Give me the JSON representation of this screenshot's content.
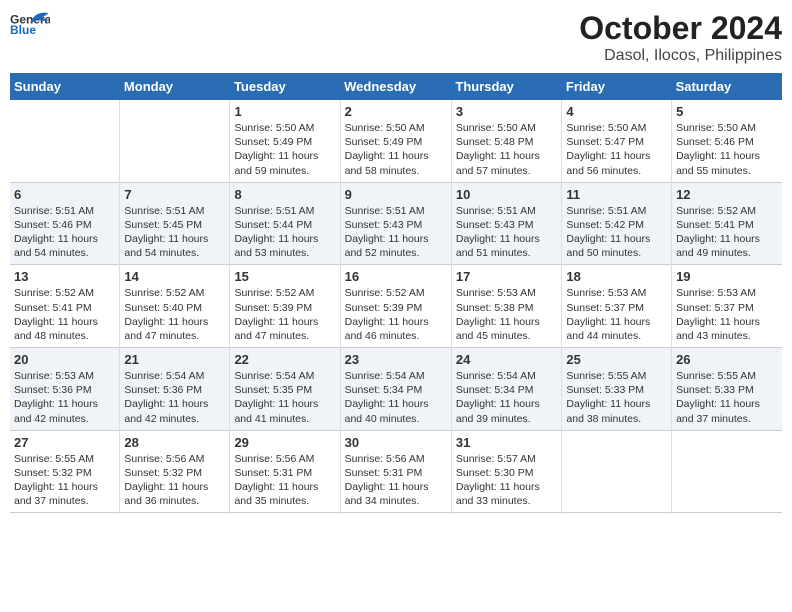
{
  "header": {
    "logo_general": "General",
    "logo_blue": "Blue",
    "title": "October 2024",
    "subtitle": "Dasol, Ilocos, Philippines"
  },
  "days_of_week": [
    "Sunday",
    "Monday",
    "Tuesday",
    "Wednesday",
    "Thursday",
    "Friday",
    "Saturday"
  ],
  "weeks": [
    {
      "shade": false,
      "days": [
        {
          "num": "",
          "text": ""
        },
        {
          "num": "",
          "text": ""
        },
        {
          "num": "1",
          "text": "Sunrise: 5:50 AM\nSunset: 5:49 PM\nDaylight: 11 hours and 59 minutes."
        },
        {
          "num": "2",
          "text": "Sunrise: 5:50 AM\nSunset: 5:49 PM\nDaylight: 11 hours and 58 minutes."
        },
        {
          "num": "3",
          "text": "Sunrise: 5:50 AM\nSunset: 5:48 PM\nDaylight: 11 hours and 57 minutes."
        },
        {
          "num": "4",
          "text": "Sunrise: 5:50 AM\nSunset: 5:47 PM\nDaylight: 11 hours and 56 minutes."
        },
        {
          "num": "5",
          "text": "Sunrise: 5:50 AM\nSunset: 5:46 PM\nDaylight: 11 hours and 55 minutes."
        }
      ]
    },
    {
      "shade": true,
      "days": [
        {
          "num": "6",
          "text": "Sunrise: 5:51 AM\nSunset: 5:46 PM\nDaylight: 11 hours and 54 minutes."
        },
        {
          "num": "7",
          "text": "Sunrise: 5:51 AM\nSunset: 5:45 PM\nDaylight: 11 hours and 54 minutes."
        },
        {
          "num": "8",
          "text": "Sunrise: 5:51 AM\nSunset: 5:44 PM\nDaylight: 11 hours and 53 minutes."
        },
        {
          "num": "9",
          "text": "Sunrise: 5:51 AM\nSunset: 5:43 PM\nDaylight: 11 hours and 52 minutes."
        },
        {
          "num": "10",
          "text": "Sunrise: 5:51 AM\nSunset: 5:43 PM\nDaylight: 11 hours and 51 minutes."
        },
        {
          "num": "11",
          "text": "Sunrise: 5:51 AM\nSunset: 5:42 PM\nDaylight: 11 hours and 50 minutes."
        },
        {
          "num": "12",
          "text": "Sunrise: 5:52 AM\nSunset: 5:41 PM\nDaylight: 11 hours and 49 minutes."
        }
      ]
    },
    {
      "shade": false,
      "days": [
        {
          "num": "13",
          "text": "Sunrise: 5:52 AM\nSunset: 5:41 PM\nDaylight: 11 hours and 48 minutes."
        },
        {
          "num": "14",
          "text": "Sunrise: 5:52 AM\nSunset: 5:40 PM\nDaylight: 11 hours and 47 minutes."
        },
        {
          "num": "15",
          "text": "Sunrise: 5:52 AM\nSunset: 5:39 PM\nDaylight: 11 hours and 47 minutes."
        },
        {
          "num": "16",
          "text": "Sunrise: 5:52 AM\nSunset: 5:39 PM\nDaylight: 11 hours and 46 minutes."
        },
        {
          "num": "17",
          "text": "Sunrise: 5:53 AM\nSunset: 5:38 PM\nDaylight: 11 hours and 45 minutes."
        },
        {
          "num": "18",
          "text": "Sunrise: 5:53 AM\nSunset: 5:37 PM\nDaylight: 11 hours and 44 minutes."
        },
        {
          "num": "19",
          "text": "Sunrise: 5:53 AM\nSunset: 5:37 PM\nDaylight: 11 hours and 43 minutes."
        }
      ]
    },
    {
      "shade": true,
      "days": [
        {
          "num": "20",
          "text": "Sunrise: 5:53 AM\nSunset: 5:36 PM\nDaylight: 11 hours and 42 minutes."
        },
        {
          "num": "21",
          "text": "Sunrise: 5:54 AM\nSunset: 5:36 PM\nDaylight: 11 hours and 42 minutes."
        },
        {
          "num": "22",
          "text": "Sunrise: 5:54 AM\nSunset: 5:35 PM\nDaylight: 11 hours and 41 minutes."
        },
        {
          "num": "23",
          "text": "Sunrise: 5:54 AM\nSunset: 5:34 PM\nDaylight: 11 hours and 40 minutes."
        },
        {
          "num": "24",
          "text": "Sunrise: 5:54 AM\nSunset: 5:34 PM\nDaylight: 11 hours and 39 minutes."
        },
        {
          "num": "25",
          "text": "Sunrise: 5:55 AM\nSunset: 5:33 PM\nDaylight: 11 hours and 38 minutes."
        },
        {
          "num": "26",
          "text": "Sunrise: 5:55 AM\nSunset: 5:33 PM\nDaylight: 11 hours and 37 minutes."
        }
      ]
    },
    {
      "shade": false,
      "days": [
        {
          "num": "27",
          "text": "Sunrise: 5:55 AM\nSunset: 5:32 PM\nDaylight: 11 hours and 37 minutes."
        },
        {
          "num": "28",
          "text": "Sunrise: 5:56 AM\nSunset: 5:32 PM\nDaylight: 11 hours and 36 minutes."
        },
        {
          "num": "29",
          "text": "Sunrise: 5:56 AM\nSunset: 5:31 PM\nDaylight: 11 hours and 35 minutes."
        },
        {
          "num": "30",
          "text": "Sunrise: 5:56 AM\nSunset: 5:31 PM\nDaylight: 11 hours and 34 minutes."
        },
        {
          "num": "31",
          "text": "Sunrise: 5:57 AM\nSunset: 5:30 PM\nDaylight: 11 hours and 33 minutes."
        },
        {
          "num": "",
          "text": ""
        },
        {
          "num": "",
          "text": ""
        }
      ]
    }
  ]
}
